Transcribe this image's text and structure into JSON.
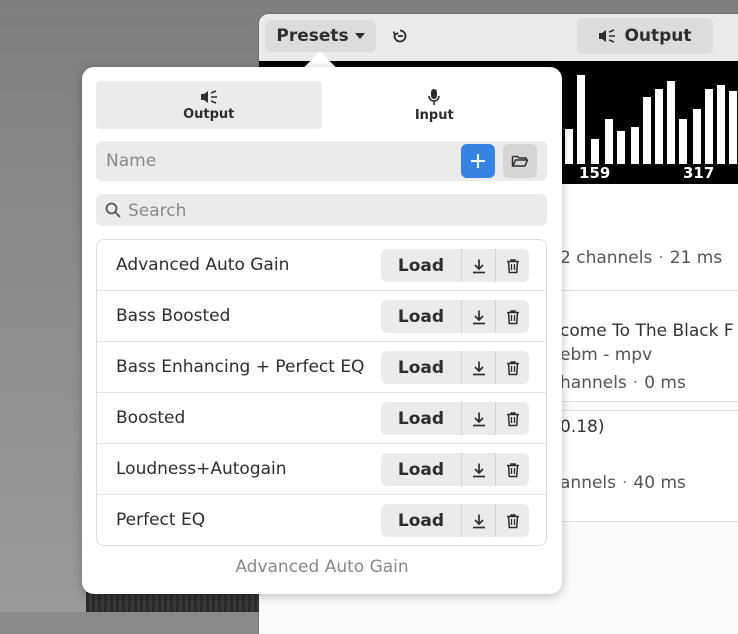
{
  "background_app": {
    "presets_label": "Presets",
    "output_label": "Output",
    "spectrum_labels": [
      "159",
      "317"
    ],
    "cards": [
      {
        "line1": "2 channels",
        "line1b": "21 ms"
      },
      {
        "title": "come To The Black F",
        "subtitle": "ebm - mpv",
        "line": "hannels",
        "lineb": "0 ms"
      },
      {
        "title": "0.18)",
        "line": "annels",
        "lineb": "40 ms"
      }
    ]
  },
  "popover": {
    "tabs": [
      {
        "label": "Output",
        "icon": "speaker-icon",
        "active": true
      },
      {
        "label": "Input",
        "icon": "microphone-icon",
        "active": false
      }
    ],
    "name_placeholder": "Name",
    "search_placeholder": "Search",
    "load_label": "Load",
    "presets": [
      {
        "name": "Advanced Auto Gain"
      },
      {
        "name": "Bass Boosted"
      },
      {
        "name": "Bass Enhancing + Perfect EQ"
      },
      {
        "name": "Boosted"
      },
      {
        "name": "Loudness+Autogain"
      },
      {
        "name": "Perfect EQ"
      }
    ],
    "current_preset": "Advanced Auto Gain"
  },
  "colors": {
    "accent": "#3584e4"
  }
}
